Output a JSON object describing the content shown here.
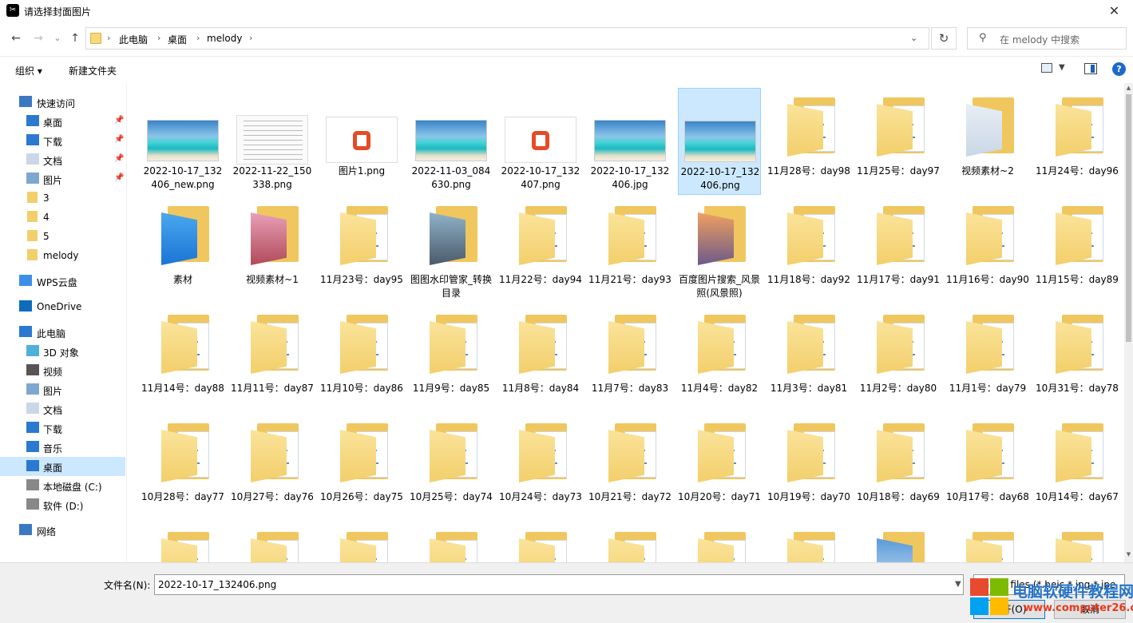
{
  "window": {
    "title": "请选择封面图片",
    "app_icon": "capcut-icon"
  },
  "nav": {
    "back": "←",
    "forward": "→",
    "recent": "⌄",
    "up": "↑",
    "breadcrumb": [
      "此电脑",
      "桌面",
      "melody"
    ],
    "search_placeholder": "在 melody 中搜索"
  },
  "toolbar": {
    "organize": "组织 ▾",
    "new_folder": "新建文件夹",
    "help": "?"
  },
  "sidebar": [
    {
      "label": "快速访问",
      "icon": "star-icon"
    },
    {
      "label": "桌面",
      "icon": "desktop-icon",
      "pinned": true
    },
    {
      "label": "下载",
      "icon": "download-icon",
      "pinned": true
    },
    {
      "label": "文档",
      "icon": "document-icon",
      "pinned": true
    },
    {
      "label": "图片",
      "icon": "picture-icon",
      "pinned": true
    },
    {
      "label": "3",
      "icon": "folder-icon"
    },
    {
      "label": "4",
      "icon": "folder-icon"
    },
    {
      "label": "5",
      "icon": "folder-icon"
    },
    {
      "label": "melody",
      "icon": "folder-icon"
    },
    {
      "label": "WPS云盘",
      "icon": "cloud-icon"
    },
    {
      "label": "OneDrive",
      "icon": "onedrive-icon"
    },
    {
      "label": "此电脑",
      "icon": "computer-icon"
    },
    {
      "label": "3D 对象",
      "icon": "cube-icon"
    },
    {
      "label": "视频",
      "icon": "video-icon"
    },
    {
      "label": "图片",
      "icon": "picture-icon"
    },
    {
      "label": "文档",
      "icon": "document-icon"
    },
    {
      "label": "下载",
      "icon": "download-icon"
    },
    {
      "label": "音乐",
      "icon": "music-icon"
    },
    {
      "label": "桌面",
      "icon": "desktop-icon",
      "selected": true
    },
    {
      "label": "本地磁盘 (C:)",
      "icon": "drive-icon"
    },
    {
      "label": "软件 (D:)",
      "icon": "drive-icon"
    },
    {
      "label": "网络",
      "icon": "network-icon"
    }
  ],
  "files": [
    {
      "label": "2022-10-17_132406_new.png",
      "kind": "beach"
    },
    {
      "label": "2022-11-22_150338.png",
      "kind": "doc"
    },
    {
      "label": "图片1.png",
      "kind": "office"
    },
    {
      "label": "2022-11-03_084630.png",
      "kind": "beach"
    },
    {
      "label": "2022-10-17_132407.png",
      "kind": "office"
    },
    {
      "label": "2022-10-17_132406.jpg",
      "kind": "beach"
    },
    {
      "label": "2022-10-17_132406.png",
      "kind": "beach",
      "selected": true
    },
    {
      "label": "11月28号：day98",
      "kind": "folder"
    },
    {
      "label": "11月25号：day97",
      "kind": "folder"
    },
    {
      "label": "视频素材~2",
      "kind": "folder-media"
    },
    {
      "label": "11月24号：day96",
      "kind": "folder"
    },
    {
      "label": "素材",
      "kind": "folder-blue"
    },
    {
      "label": "视频素材~1",
      "kind": "folder-pink"
    },
    {
      "label": "11月23号：day95",
      "kind": "folder"
    },
    {
      "label": "图图水印管家_转换目录",
      "kind": "folder-road"
    },
    {
      "label": "11月22号：day94",
      "kind": "folder"
    },
    {
      "label": "11月21号：day93",
      "kind": "folder"
    },
    {
      "label": "百度图片搜索_风景照(风景照)",
      "kind": "folder-sunset"
    },
    {
      "label": "11月18号：day92",
      "kind": "folder"
    },
    {
      "label": "11月17号：day91",
      "kind": "folder"
    },
    {
      "label": "11月16号：day90",
      "kind": "folder"
    },
    {
      "label": "11月15号：day89",
      "kind": "folder"
    },
    {
      "label": "11月14号：day88",
      "kind": "folder"
    },
    {
      "label": "11月11号：day87",
      "kind": "folder"
    },
    {
      "label": "11月10号：day86",
      "kind": "folder"
    },
    {
      "label": "11月9号：day85",
      "kind": "folder"
    },
    {
      "label": "11月8号：day84",
      "kind": "folder"
    },
    {
      "label": "11月7号：day83",
      "kind": "folder"
    },
    {
      "label": "11月4号：day82",
      "kind": "folder"
    },
    {
      "label": "11月3号：day81",
      "kind": "folder"
    },
    {
      "label": "11月2号：day80",
      "kind": "folder"
    },
    {
      "label": "11月1号：day79",
      "kind": "folder"
    },
    {
      "label": "10月31号：day78",
      "kind": "folder"
    },
    {
      "label": "10月28号：day77",
      "kind": "folder"
    },
    {
      "label": "10月27号：day76",
      "kind": "folder"
    },
    {
      "label": "10月26号：day75",
      "kind": "folder"
    },
    {
      "label": "10月25号：day74",
      "kind": "folder"
    },
    {
      "label": "10月24号：day73",
      "kind": "folder"
    },
    {
      "label": "10月21号：day72",
      "kind": "folder"
    },
    {
      "label": "10月20号：day71",
      "kind": "folder"
    },
    {
      "label": "10月19号：day70",
      "kind": "folder"
    },
    {
      "label": "10月18号：day69",
      "kind": "folder"
    },
    {
      "label": "10月17号：day68",
      "kind": "folder"
    },
    {
      "label": "10月14号：day67",
      "kind": "folder"
    },
    {
      "label": "",
      "kind": "folder"
    },
    {
      "label": "",
      "kind": "folder"
    },
    {
      "label": "",
      "kind": "folder"
    },
    {
      "label": "",
      "kind": "folder"
    },
    {
      "label": "",
      "kind": "folder"
    },
    {
      "label": "",
      "kind": "folder"
    },
    {
      "label": "",
      "kind": "folder"
    },
    {
      "label": "",
      "kind": "folder"
    },
    {
      "label": "",
      "kind": "folder-mountain"
    },
    {
      "label": "",
      "kind": "folder"
    },
    {
      "label": "",
      "kind": "folder"
    }
  ],
  "footer": {
    "filename_label": "文件名(N):",
    "filename_value": "2022-10-17_132406.png",
    "type_value": "Image files (*.heic *.jpg *.jpe",
    "open": "打开(O)",
    "cancel": "取消"
  },
  "watermark": {
    "title": "电脑软硬件教程网",
    "url": "www.computer26.com"
  },
  "colors": {
    "selection": "#cce8ff",
    "folder": "#f3cf6b",
    "accent": "#0078d7"
  }
}
